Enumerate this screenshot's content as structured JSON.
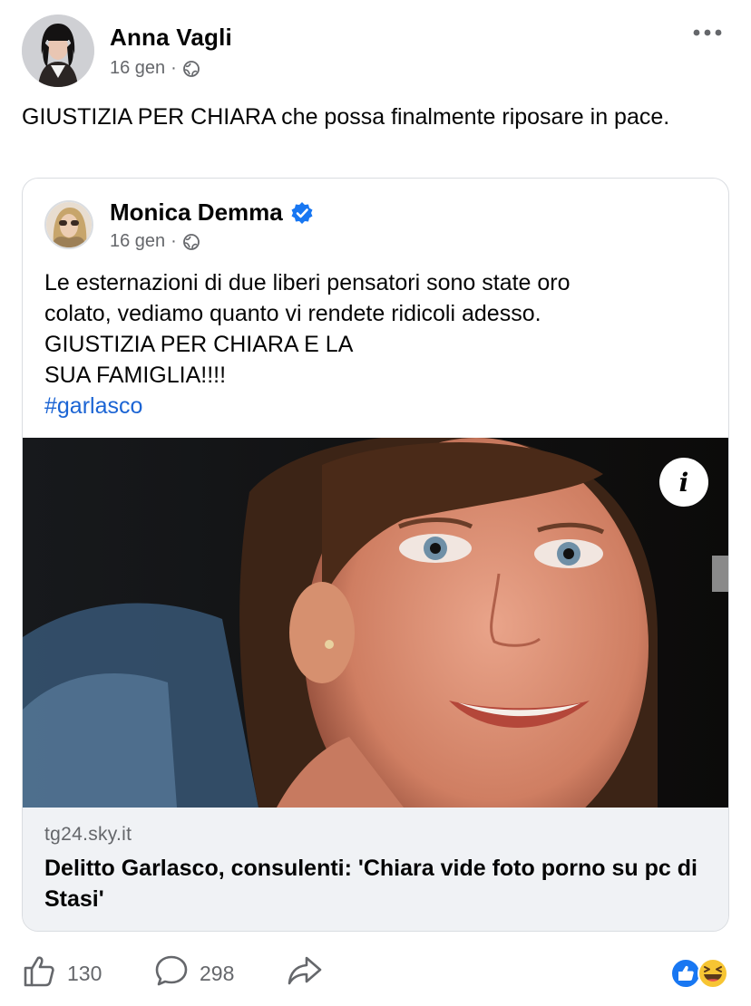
{
  "post": {
    "author": "Anna Vagli",
    "date": "16 gen",
    "separator": "·",
    "text": "GIUSTIZIA PER CHIARA che possa finalmente riposare in pace."
  },
  "shared": {
    "author": "Monica Demma",
    "date": "16 gen",
    "separator": "·",
    "text_lines": [
      "Le esternazioni di due liberi pensatori sono state oro",
      "colato, vediamo quanto vi rendete ridicoli adesso.",
      "GIUSTIZIA PER CHIARA E LA",
      "SUA FAMIGLIA!!!!"
    ],
    "hashtag": "#garlasco"
  },
  "link": {
    "domain": "tg24.sky.it",
    "title": "Delitto Garlasco, consulenti: 'Chiara vide foto porno su pc di Stasi'",
    "info_icon": "i"
  },
  "actions": {
    "likes": "130",
    "comments": "298"
  },
  "icons": {
    "more": "more-dots-icon",
    "audience": "globe-icon",
    "verified": "verified-badge-icon",
    "like": "thumbs-up-icon",
    "comment": "comment-bubble-icon",
    "share": "share-arrow-icon",
    "reactions": [
      "like-reaction-icon",
      "haha-reaction-icon"
    ]
  },
  "colors": {
    "primary_text": "#050505",
    "secondary_text": "#65676b",
    "link_blue": "#1b64d4",
    "verified_blue": "#1877f2",
    "link_footer_bg": "#f0f2f5",
    "card_border": "#dadde1"
  }
}
